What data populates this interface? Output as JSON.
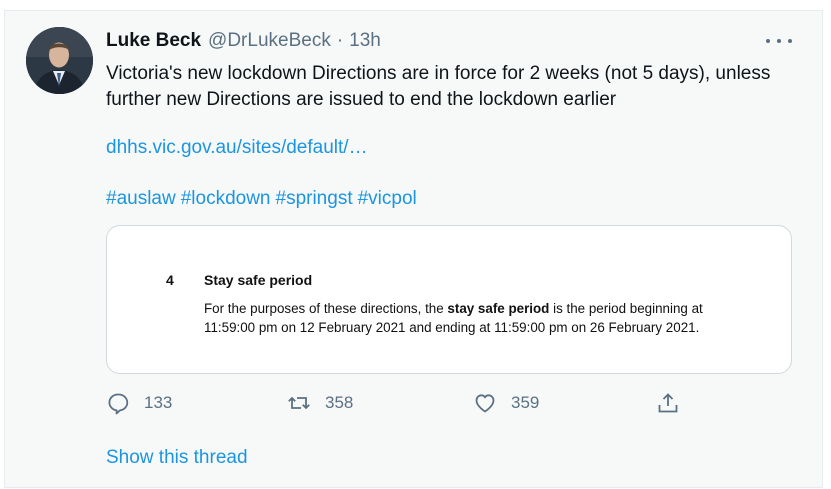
{
  "tweet": {
    "author_name": "Luke Beck",
    "handle": "@DrLukeBeck",
    "separator": "·",
    "time": "13h",
    "text": "Victoria's new lockdown Directions are in force for 2 weeks (not 5 days), unless further new Directions are issued to end the lockdown earlier",
    "link": "dhhs.vic.gov.au/sites/default/…",
    "hashtags": [
      "#auslaw",
      "#lockdown",
      "#springst",
      "#vicpol"
    ]
  },
  "document": {
    "section_number": "4",
    "section_title": "Stay safe period",
    "body_before": "For the purposes of these directions, the ",
    "body_bold": "stay safe period",
    "body_after": " is the period beginning at 11:59:00 pm on 12 February 2021 and ending at 11:59:00 pm on 26 February 2021."
  },
  "actions": {
    "reply_icon": "reply-icon",
    "reply_count": "133",
    "retweet_icon": "retweet-icon",
    "retweet_count": "358",
    "like_icon": "heart-icon",
    "like_count": "359",
    "share_icon": "share-icon"
  },
  "show_thread": "Show this thread",
  "colors": {
    "link": "#1b95e0",
    "secondary_text": "#5b7083",
    "background": "#f7f9f9"
  }
}
